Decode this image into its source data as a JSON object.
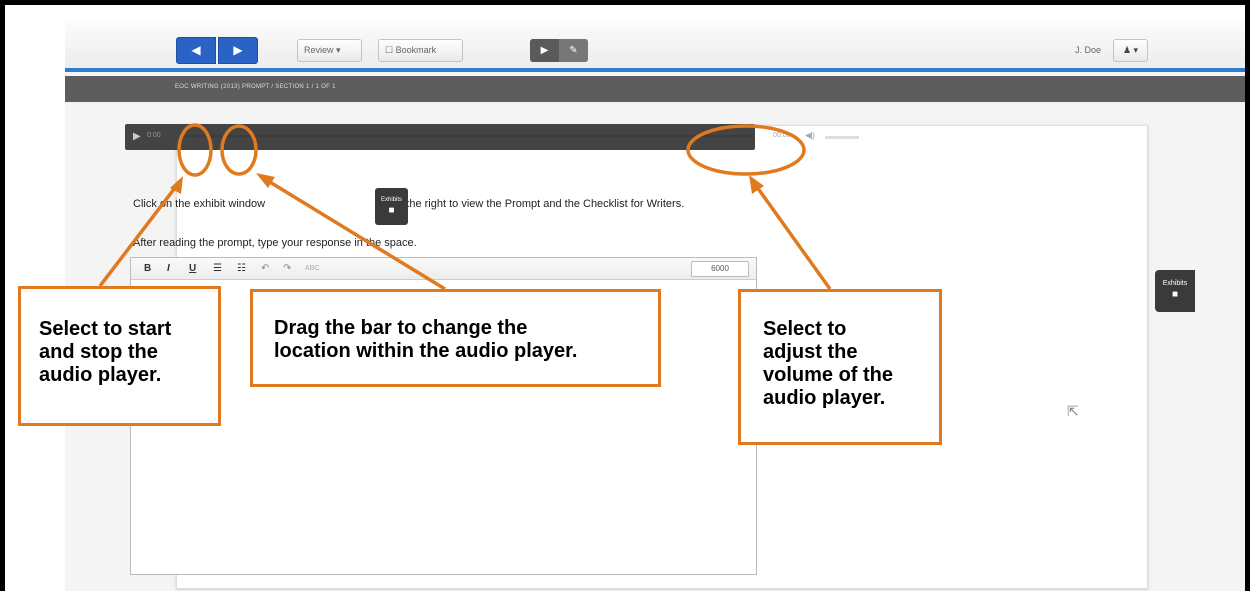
{
  "toolbar": {
    "prev_icon": "◀",
    "next_icon": "▶",
    "review_label": "Review ▾",
    "bookmark_label": "☐ Bookmark",
    "pointer_tool": "▶",
    "highlight_tool": "✎",
    "user_name": "J. Doe",
    "user_menu": "♟ ▾"
  },
  "breadcrumb": "EOC WRITING (2013) PROMPT   /   SECTION 1   /   1 OF 1",
  "audio": {
    "play_icon": "▶",
    "elapsed": "0:00",
    "time": "00:00",
    "volume_icon": "◀)"
  },
  "instructions": {
    "line1_start": "Click on the exhibit window",
    "line1_end": "on the right to view the Prompt and the Checklist for Writers.",
    "line2": "After reading the prompt, type your response in the space."
  },
  "exhibit_label": "Exhibits",
  "editor": {
    "bold": "B",
    "italic": "I",
    "underline": "U",
    "bullets": "☰",
    "numbers": "☷",
    "undo": "↶",
    "redo": "↷",
    "spell": "ABC",
    "counter": "6000"
  },
  "callouts": {
    "start_stop": [
      "Select to start",
      "and stop the",
      "audio player."
    ],
    "drag_bar": [
      "Drag the bar to change the",
      "location within the audio player."
    ],
    "volume": [
      "Select to",
      "adjust the",
      "volume of the",
      "audio player."
    ]
  },
  "colors": {
    "accent": "#2a63c6",
    "annotation": "#e07a1e",
    "crumb_bar": "#5d5d5d"
  }
}
